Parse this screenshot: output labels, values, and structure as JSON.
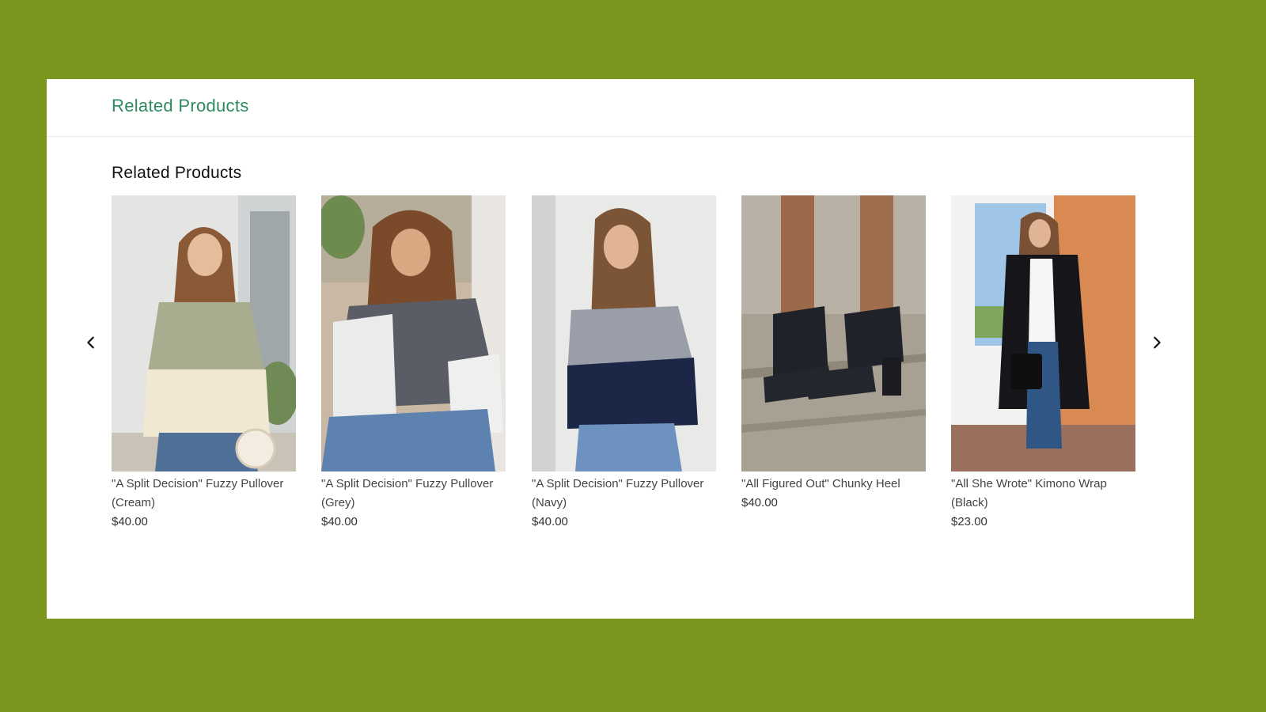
{
  "header": {
    "title": "Related Products"
  },
  "section": {
    "title": "Related Products"
  },
  "carousel": {
    "prev_icon": "chevron-left-icon",
    "next_icon": "chevron-right-icon"
  },
  "products": [
    {
      "name": "\"A Split Decision\" Fuzzy Pullover (Cream)",
      "price": "$40.00"
    },
    {
      "name": "\"A Split Decision\" Fuzzy Pullover (Grey)",
      "price": "$40.00"
    },
    {
      "name": "\"A Split Decision\" Fuzzy Pullover (Navy)",
      "price": "$40.00"
    },
    {
      "name": "\"All Figured Out\" Chunky Heel",
      "price": "$40.00"
    },
    {
      "name": "\"All She Wrote\" Kimono Wrap (Black)",
      "price": "$23.00"
    }
  ],
  "colors": {
    "page_background": "#7a961c",
    "header_accent": "#2e8a5f",
    "card_background": "#ffffff"
  }
}
